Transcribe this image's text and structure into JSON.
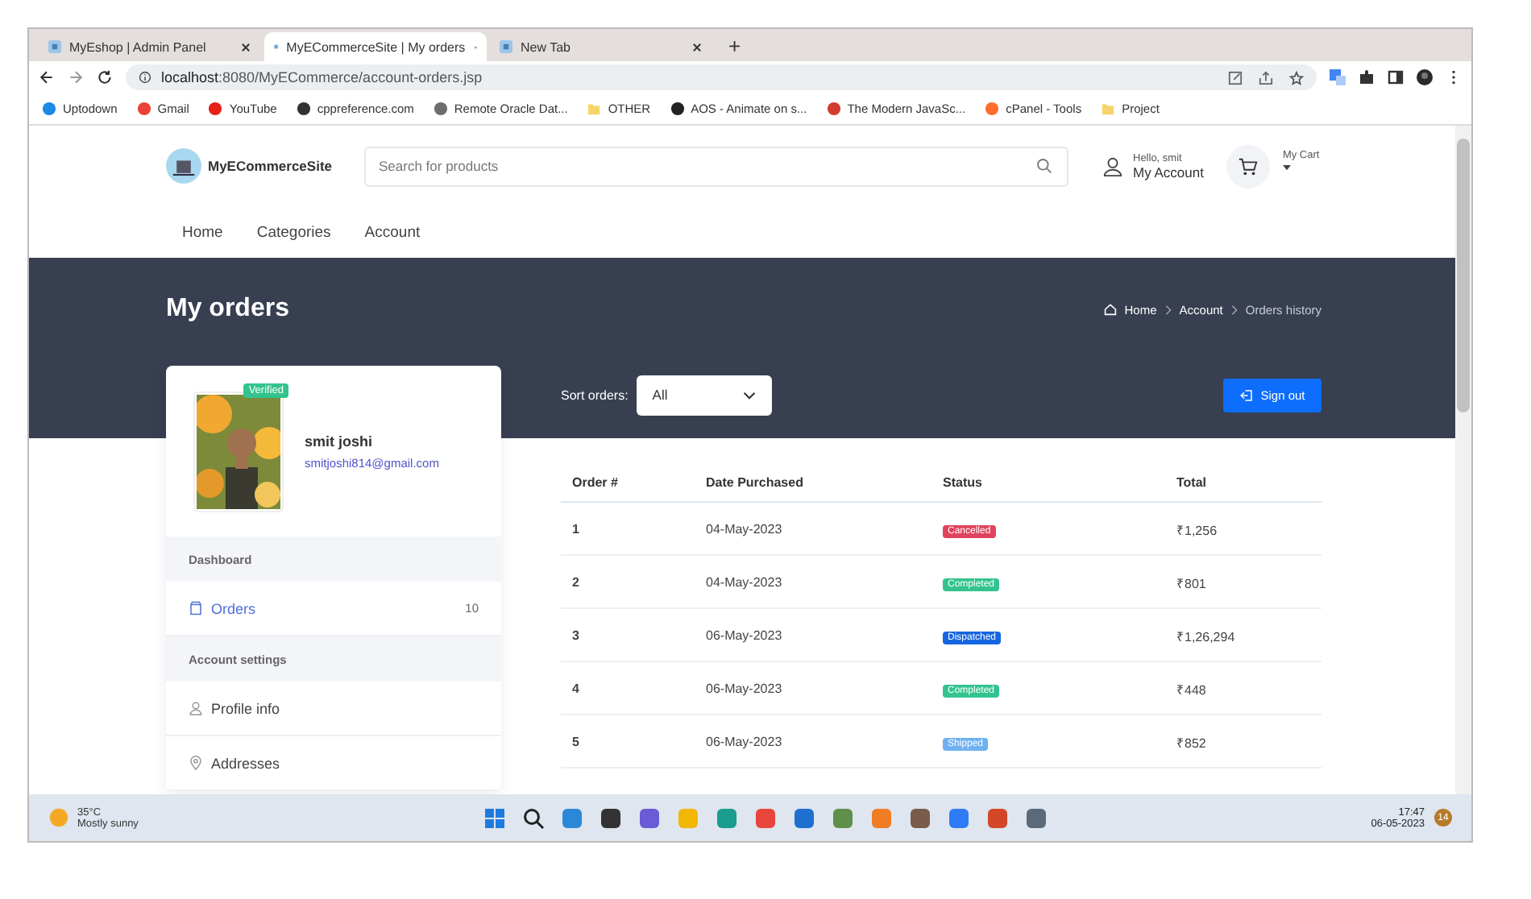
{
  "browser": {
    "tabs": [
      {
        "title": "MyEshop | Admin Panel",
        "selected": false
      },
      {
        "title": "MyECommerceSite | My orders",
        "selected": true
      },
      {
        "title": "New Tab",
        "selected": false
      }
    ],
    "new_tab": "+",
    "url_host": "localhost",
    "url_path": ":8080/MyECommerce/account-orders.jsp",
    "bookmarks": [
      {
        "label": "Uptodown",
        "kind": "site",
        "color": "#1e88e5"
      },
      {
        "label": "Gmail",
        "kind": "site",
        "color": "#ea4335"
      },
      {
        "label": "YouTube",
        "kind": "site",
        "color": "#e62117"
      },
      {
        "label": "cppreference.com",
        "kind": "site",
        "color": "#333333"
      },
      {
        "label": "Remote Oracle Dat...",
        "kind": "site",
        "color": "#6d6d6d"
      },
      {
        "label": "OTHER",
        "kind": "folder",
        "color": "#f5d56b"
      },
      {
        "label": "AOS - Animate on s...",
        "kind": "site",
        "color": "#222222"
      },
      {
        "label": "The Modern JavaSc...",
        "kind": "site",
        "color": "#d23b2f"
      },
      {
        "label": "cPanel - Tools",
        "kind": "site",
        "color": "#ff6c2c"
      },
      {
        "label": "Project",
        "kind": "folder",
        "color": "#f5d56b"
      }
    ]
  },
  "site": {
    "logo": "MyECommerceSite",
    "search": {
      "placeholder": "Search for products"
    },
    "account": {
      "greeting": "Hello, smit",
      "label": "My Account"
    },
    "cart": {
      "label": "My Cart"
    },
    "nav": [
      "Home",
      "Categories",
      "Account"
    ]
  },
  "hero": {
    "title": "My orders",
    "breadcrumb": [
      "Home",
      "Account",
      "Orders history"
    ]
  },
  "profile": {
    "name": "smit joshi",
    "email": "smitjoshi814@gmail.com",
    "badge": "Verified"
  },
  "sidebar": [
    {
      "kind": "heading",
      "label": "Dashboard"
    },
    {
      "kind": "link",
      "label": "Orders",
      "count": "10",
      "selected": true
    },
    {
      "kind": "heading",
      "label": "Account settings"
    },
    {
      "kind": "link",
      "label": "Profile info",
      "selected": false
    },
    {
      "kind": "link",
      "label": "Addresses",
      "selected": false
    }
  ],
  "sort": {
    "label": "Sort orders:",
    "value": "All"
  },
  "sign_out": "Sign out",
  "table": {
    "columns": [
      "Order #",
      "Date Purchased",
      "Status",
      "Total"
    ],
    "rows": [
      {
        "order": "1",
        "date": "04-May-2023",
        "status": "Cancelled",
        "color": "#e0435c",
        "total": "₹1,256"
      },
      {
        "order": "2",
        "date": "04-May-2023",
        "status": "Completed",
        "color": "#34c38f",
        "total": "₹801"
      },
      {
        "order": "3",
        "date": "06-May-2023",
        "status": "Dispatched",
        "color": "#1565e0",
        "total": "₹1,26,294"
      },
      {
        "order": "4",
        "date": "06-May-2023",
        "status": "Completed",
        "color": "#34c38f",
        "total": "₹448"
      },
      {
        "order": "5",
        "date": "06-May-2023",
        "status": "Shipped",
        "color": "#6fb1f0",
        "total": "₹852"
      }
    ]
  },
  "taskbar": {
    "temp": "35°C",
    "weather": "Mostly sunny",
    "time": "17:47",
    "date": "06-05-2023",
    "badge": "14"
  }
}
